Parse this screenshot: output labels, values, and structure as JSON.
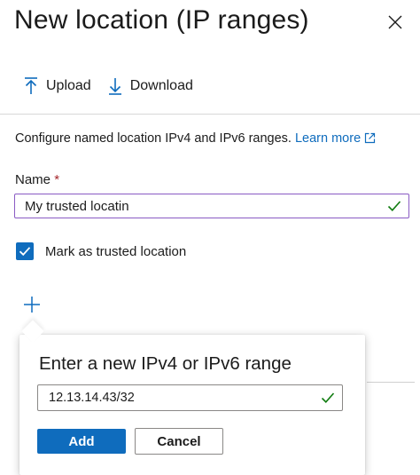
{
  "panel": {
    "title": "New location (IP ranges)",
    "close_icon": "close-icon"
  },
  "toolbar": {
    "upload_label": "Upload",
    "download_label": "Download"
  },
  "description": {
    "text": "Configure named location IPv4 and IPv6 ranges.",
    "link_text": "Learn more"
  },
  "name_field": {
    "label": "Name",
    "required_marker": "*",
    "value": "My trusted locatin"
  },
  "trusted_checkbox": {
    "label": "Mark as trusted location",
    "checked": true
  },
  "add_range_icon": "plus-icon",
  "popup": {
    "title": "Enter a new IPv4 or IPv6 range",
    "ip_value": "12.13.14.43/32",
    "add_label": "Add",
    "cancel_label": "Cancel"
  },
  "colors": {
    "accent": "#0f6cbd",
    "focus_border": "#8a5bc4",
    "valid_check": "#107c10",
    "required": "#a4262c"
  }
}
